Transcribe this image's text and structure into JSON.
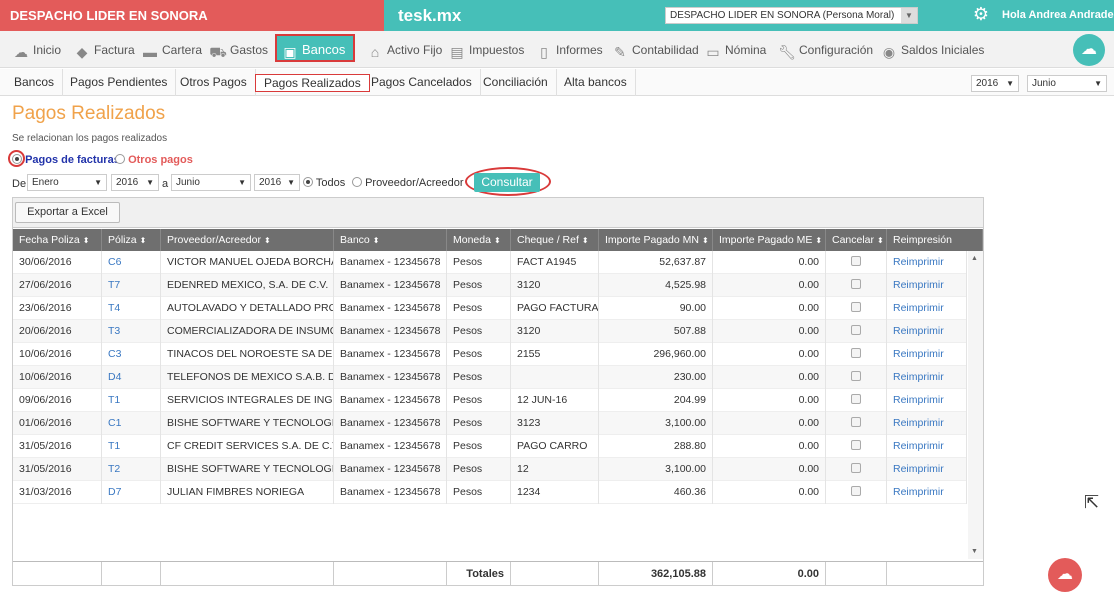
{
  "topbar": {
    "brand": "DESPACHO LIDER EN SONORA",
    "app_title": "tesk.mx",
    "company_select": "DESPACHO LIDER EN SONORA (Persona Moral)",
    "greeting": "Hola Andrea Andrade"
  },
  "mainnav": {
    "items": [
      {
        "label": "Inicio",
        "icon": "cloud-icon"
      },
      {
        "label": "Factura",
        "icon": "tag-icon"
      },
      {
        "label": "Cartera",
        "icon": "briefcase-icon"
      },
      {
        "label": "Gastos",
        "icon": "cart-icon"
      },
      {
        "label": "Bancos",
        "icon": "bank-card-icon"
      },
      {
        "label": "Activo Fijo",
        "icon": "house-icon"
      },
      {
        "label": "Impuestos",
        "icon": "coins-icon"
      },
      {
        "label": "Informes",
        "icon": "document-icon"
      },
      {
        "label": "Contabilidad",
        "icon": "ledger-icon"
      },
      {
        "label": "Nómina",
        "icon": "payroll-icon"
      },
      {
        "label": "Configuración",
        "icon": "wrench-icon"
      },
      {
        "label": "Saldos Iniciales",
        "icon": "balance-icon"
      }
    ]
  },
  "subnav": {
    "tabs": [
      "Bancos",
      "Pagos Pendientes",
      "Otros Pagos",
      "Pagos Realizados",
      "Pagos Cancelados",
      "Conciliación",
      "Alta bancos"
    ],
    "year": "2016",
    "month": "Junio"
  },
  "page": {
    "title": "Pagos Realizados",
    "subtitle": "Se relacionan los pagos realizados",
    "option_facturas": "Pagos de facturas",
    "option_otros": "Otros pagos"
  },
  "filters": {
    "de_label": "De",
    "a_label": "a",
    "from_month": "Enero",
    "from_year": "2016",
    "to_month": "Junio",
    "to_year": "2016",
    "todos_label": "Todos",
    "proveedor_label": "Proveedor/Acreedor",
    "consultar": "Consultar"
  },
  "grid": {
    "export_label": "Exportar a Excel",
    "columns": [
      "Fecha Poliza",
      "Póliza",
      "Proveedor/Acreedor",
      "Banco",
      "Moneda",
      "Cheque / Ref",
      "Importe Pagado MN",
      "Importe Pagado ME",
      "Cancelar",
      "Reimpresión"
    ],
    "rows": [
      {
        "fecha": "30/06/2016",
        "poliza": "C6",
        "proveedor": "VICTOR MANUEL OJEDA BORCHA...",
        "banco": "Banamex - 12345678",
        "moneda": "Pesos",
        "ref": "FACT A1945",
        "mn": "52,637.87",
        "me": "0.00",
        "reimp": "Reimprimir"
      },
      {
        "fecha": "27/06/2016",
        "poliza": "T7",
        "proveedor": "EDENRED MEXICO, S.A. DE C.V.",
        "banco": "Banamex - 12345678",
        "moneda": "Pesos",
        "ref": "3120",
        "mn": "4,525.98",
        "me": "0.00",
        "reimp": "Reimprimir"
      },
      {
        "fecha": "23/06/2016",
        "poliza": "T4",
        "proveedor": "AUTOLAVADO Y DETALLADO PRO...",
        "banco": "Banamex - 12345678",
        "moneda": "Pesos",
        "ref": "PAGO FACTURA",
        "mn": "90.00",
        "me": "0.00",
        "reimp": "Reimprimir"
      },
      {
        "fecha": "20/06/2016",
        "poliza": "T3",
        "proveedor": "COMERCIALIZADORA DE INSUMO...",
        "banco": "Banamex - 12345678",
        "moneda": "Pesos",
        "ref": "3120",
        "mn": "507.88",
        "me": "0.00",
        "reimp": "Reimprimir"
      },
      {
        "fecha": "10/06/2016",
        "poliza": "C3",
        "proveedor": "TINACOS DEL NOROESTE SA DE CV",
        "banco": "Banamex - 12345678",
        "moneda": "Pesos",
        "ref": "2155",
        "mn": "296,960.00",
        "me": "0.00",
        "reimp": "Reimprimir"
      },
      {
        "fecha": "10/06/2016",
        "poliza": "D4",
        "proveedor": "TELEFONOS DE MEXICO S.A.B. DE...",
        "banco": "Banamex - 12345678",
        "moneda": "Pesos",
        "ref": "",
        "mn": "230.00",
        "me": "0.00",
        "reimp": "Reimprimir"
      },
      {
        "fecha": "09/06/2016",
        "poliza": "T1",
        "proveedor": "SERVICIOS INTEGRALES DE INGEN...",
        "banco": "Banamex - 12345678",
        "moneda": "Pesos",
        "ref": "12 JUN-16",
        "mn": "204.99",
        "me": "0.00",
        "reimp": "Reimprimir"
      },
      {
        "fecha": "01/06/2016",
        "poliza": "C1",
        "proveedor": "BISHE SOFTWARE Y TECNOLOGIA...",
        "banco": "Banamex - 12345678",
        "moneda": "Pesos",
        "ref": "3123",
        "mn": "3,100.00",
        "me": "0.00",
        "reimp": "Reimprimir"
      },
      {
        "fecha": "31/05/2016",
        "poliza": "T1",
        "proveedor": "CF CREDIT SERVICES S.A. DE C.V. S...",
        "banco": "Banamex - 12345678",
        "moneda": "Pesos",
        "ref": "PAGO CARRO",
        "mn": "288.80",
        "me": "0.00",
        "reimp": "Reimprimir"
      },
      {
        "fecha": "31/05/2016",
        "poliza": "T2",
        "proveedor": "BISHE SOFTWARE Y TECNOLOGIA...",
        "banco": "Banamex - 12345678",
        "moneda": "Pesos",
        "ref": "12",
        "mn": "3,100.00",
        "me": "0.00",
        "reimp": "Reimprimir"
      },
      {
        "fecha": "31/03/2016",
        "poliza": "D7",
        "proveedor": "JULIAN FIMBRES NORIEGA",
        "banco": "Banamex - 12345678",
        "moneda": "Pesos",
        "ref": "1234",
        "mn": "460.36",
        "me": "0.00",
        "reimp": "Reimprimir"
      }
    ],
    "totals_label": "Totales",
    "total_mn": "362,105.88",
    "total_me": "0.00"
  },
  "colors": {
    "teal": "#46bfb8",
    "red": "#e35b5a",
    "orange_title": "#f0a24a",
    "link": "#3a78c2"
  }
}
